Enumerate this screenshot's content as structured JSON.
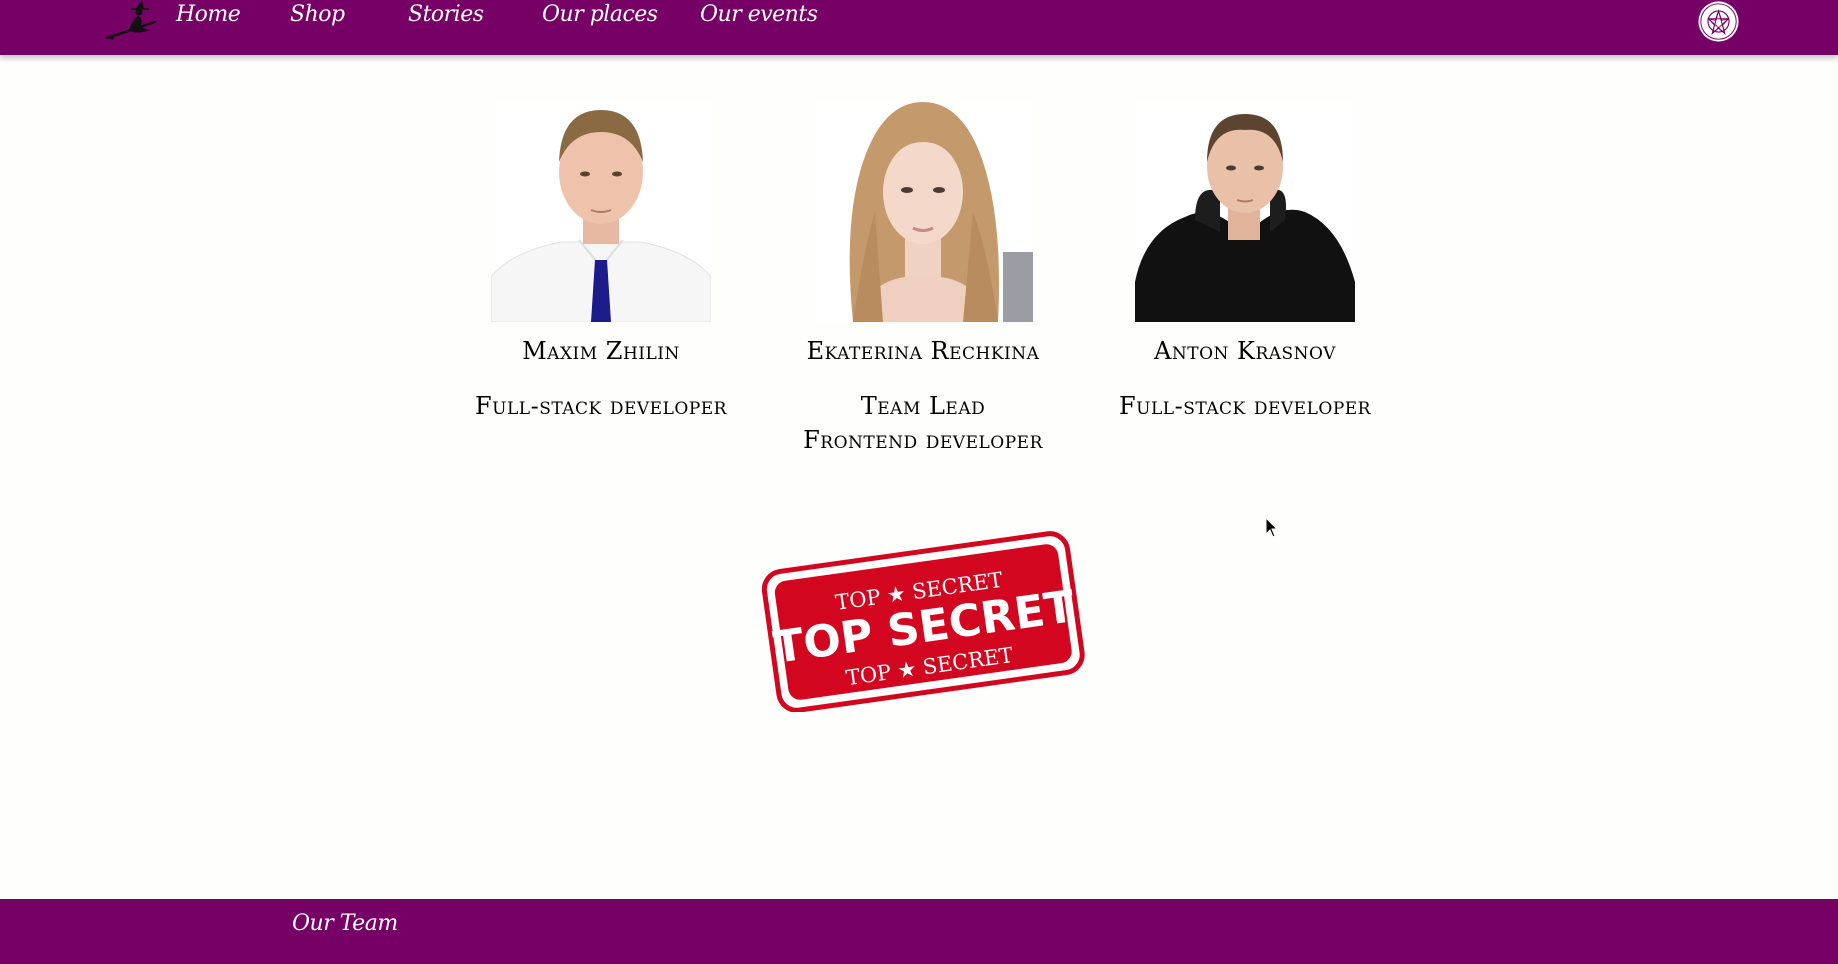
{
  "header": {
    "logo_icon": "witch-on-broom-icon",
    "nav": [
      {
        "label": "Home"
      },
      {
        "label": "Shop"
      },
      {
        "label": "Stories"
      },
      {
        "label": "Our places"
      },
      {
        "label": "Our events"
      }
    ],
    "seal_icon": "pentagram-seal-icon"
  },
  "team": [
    {
      "name": "Maxim Zhilin",
      "role_lines": [
        "Full-stack developer"
      ],
      "photo": "man-white-shirt-tie-photo"
    },
    {
      "name": "Ekaterina Rechkina",
      "role_lines": [
        "Team Lead",
        "Frontend developer"
      ],
      "photo": "woman-long-hair-photo"
    },
    {
      "name": "Anton Krasnov",
      "role_lines": [
        "Full-stack developer"
      ],
      "photo": "man-black-hoodie-photo"
    }
  ],
  "stamp": {
    "top_text": "TOP ★ SECRET",
    "main_text": "TOP SECRET",
    "bottom_text": "TOP ★ SECRET",
    "color": "#d2061f"
  },
  "footer": {
    "link": "Our Team"
  },
  "colors": {
    "brand": "#760066",
    "background": "#fefefc"
  }
}
